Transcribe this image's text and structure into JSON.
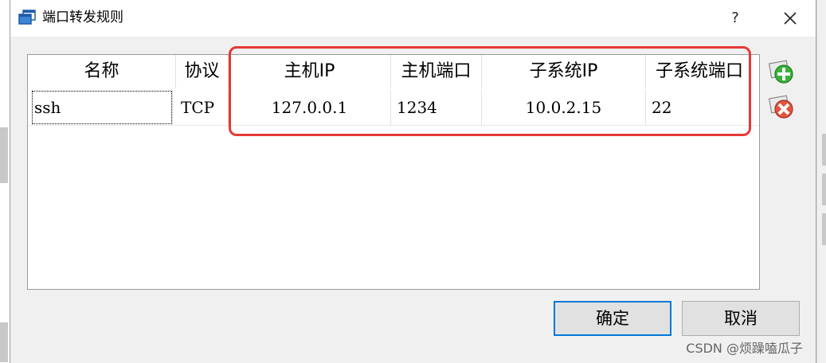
{
  "window": {
    "title": "端口转发规则",
    "help_label": "?",
    "app_icon": "virtualbox-window-icon",
    "close_icon": "close-icon"
  },
  "table": {
    "columns": [
      "名称",
      "协议",
      "主机IP",
      "主机端口",
      "子系统IP",
      "子系统端口"
    ],
    "rows": [
      [
        "ssh",
        "TCP",
        "127.0.0.1",
        "1234",
        "10.0.2.15",
        "22"
      ]
    ]
  },
  "side_actions": {
    "add_icon": "add-rule-icon",
    "remove_icon": "remove-rule-icon"
  },
  "buttons": {
    "ok": "确定",
    "cancel": "取消"
  },
  "colors": {
    "highlight": "#e53935",
    "focus_border": "#0078d7",
    "add_green": "#2e9e2e",
    "remove_red": "#d8432f"
  },
  "watermark": "CSDN @烦躁嗑瓜子"
}
